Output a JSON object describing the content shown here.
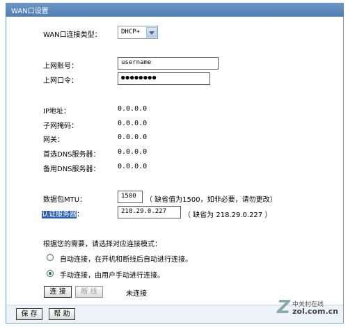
{
  "window": {
    "title": "WAN口设置"
  },
  "wan_type": {
    "label": "WAN口连接类型：",
    "selected": "DHCP+"
  },
  "account": {
    "username_label": "上网账号：",
    "username_value": "username",
    "password_label": "上网口令：",
    "password_value": "●●●●●●●●"
  },
  "info": [
    {
      "label": "IP地址：",
      "value": "0.0.0.0"
    },
    {
      "label": "子网掩码：",
      "value": "0.0.0.0"
    },
    {
      "label": "网关：",
      "value": "0.0.0.0"
    },
    {
      "label": "首选DNS服务器：",
      "value": "0.0.0.0"
    },
    {
      "label": "备用DNS服务器：",
      "value": "0.0.0.0"
    }
  ],
  "mtu": {
    "label": "数据包MTU：",
    "value": "1500",
    "hint": "（ 缺省值为1500，如非必要，请勿更改）"
  },
  "auth_server": {
    "label": "认证服务器",
    "colon": "：",
    "value": "218.29.0.227",
    "hint": "（ 缺省为 218.29.0.227 ）"
  },
  "mode": {
    "prompt": "根据您的需要，请选择对应连接模式：",
    "options": [
      {
        "label": "自动连接，在开机和断线后自动进行连接。",
        "checked": false
      },
      {
        "label": "手动连接，由用户手动进行连接。",
        "checked": true
      }
    ]
  },
  "actions": {
    "connect": "连 接",
    "disconnect": "断 线",
    "status": "未连接"
  },
  "footer": {
    "save": "保 存",
    "help": "帮 助"
  },
  "watermark": {
    "brand": "中关村在线",
    "site": "zol.com.cn"
  }
}
